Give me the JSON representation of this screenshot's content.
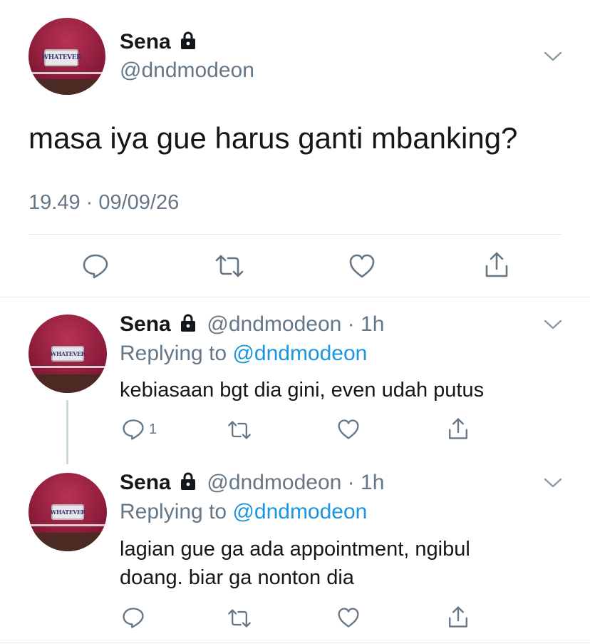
{
  "main_tweet": {
    "name": "Sena",
    "handle": "@dndmodeon",
    "text": "masa iya gue harus ganti mbanking?",
    "timestamp": "19.49 · 09/09/26",
    "avatar_plate": "WHATEVER"
  },
  "replies": [
    {
      "name": "Sena",
      "handle": "@dndmodeon",
      "separator": "·",
      "time": "1h",
      "replying_prefix": "Replying to",
      "replying_to": "@dndmodeon",
      "text_lines": [
        "kebiasaan bgt dia gini, even udah putus"
      ],
      "reply_count": "1",
      "avatar_plate": "WHATEVER"
    },
    {
      "name": "Sena",
      "handle": "@dndmodeon",
      "separator": "·",
      "time": "1h",
      "replying_prefix": "Replying to",
      "replying_to": "@dndmodeon",
      "text_lines": [
        "lagian gue ga ada appointment, ngibul",
        "doang. biar ga nonton dia"
      ],
      "reply_count": "",
      "avatar_plate": "WHATEVER"
    }
  ],
  "colors": {
    "text_primary": "#14171a",
    "text_secondary": "#657786",
    "link": "#1b95e0",
    "divider": "#e1e8ed"
  },
  "icons": [
    "lock-icon",
    "chevron-down-icon",
    "reply-icon",
    "retweet-icon",
    "like-icon",
    "share-icon"
  ]
}
